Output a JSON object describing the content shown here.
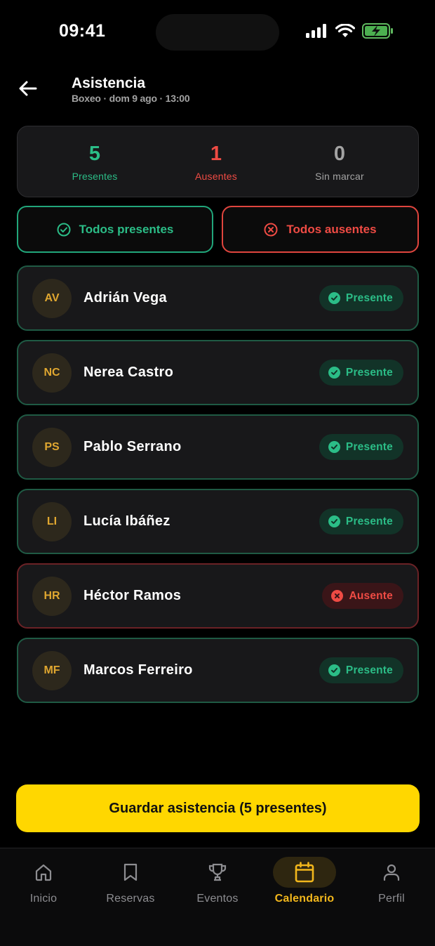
{
  "status_bar": {
    "time": "09:41"
  },
  "header": {
    "title": "Asistencia",
    "subtitle": "Boxeo · dom 9 ago · 13:00"
  },
  "stats": {
    "present": {
      "value": "5",
      "label": "Presentes",
      "color": "#2bbd87"
    },
    "absent": {
      "value": "1",
      "label": "Ausentes",
      "color": "#ef4b44"
    },
    "unmarked": {
      "value": "0",
      "label": "Sin marcar",
      "color": "#a3a3a3"
    }
  },
  "bulk": {
    "all_present": "Todos presentes",
    "all_absent": "Todos ausentes"
  },
  "attendees": [
    {
      "initials": "AV",
      "name": "Adrián Vega",
      "status": "Presente"
    },
    {
      "initials": "NC",
      "name": "Nerea Castro",
      "status": "Presente"
    },
    {
      "initials": "PS",
      "name": "Pablo Serrano",
      "status": "Presente"
    },
    {
      "initials": "LI",
      "name": "Lucía Ibáñez",
      "status": "Presente"
    },
    {
      "initials": "HR",
      "name": "Héctor Ramos",
      "status": "Ausente"
    },
    {
      "initials": "MF",
      "name": "Marcos Ferreiro",
      "status": "Presente"
    }
  ],
  "save_button": "Guardar asistencia (5 presentes)",
  "tabs": [
    {
      "label": "Inicio",
      "icon": "home-icon"
    },
    {
      "label": "Reservas",
      "icon": "bookmark-icon"
    },
    {
      "label": "Eventos",
      "icon": "trophy-icon"
    },
    {
      "label": "Calendario",
      "icon": "calendar-icon",
      "active": true
    },
    {
      "label": "Perfil",
      "icon": "user-icon"
    }
  ],
  "colors": {
    "accent": "#ffd700",
    "present": "#2bbd87",
    "absent": "#ef4b44",
    "active_tab": "#f2b71c"
  }
}
